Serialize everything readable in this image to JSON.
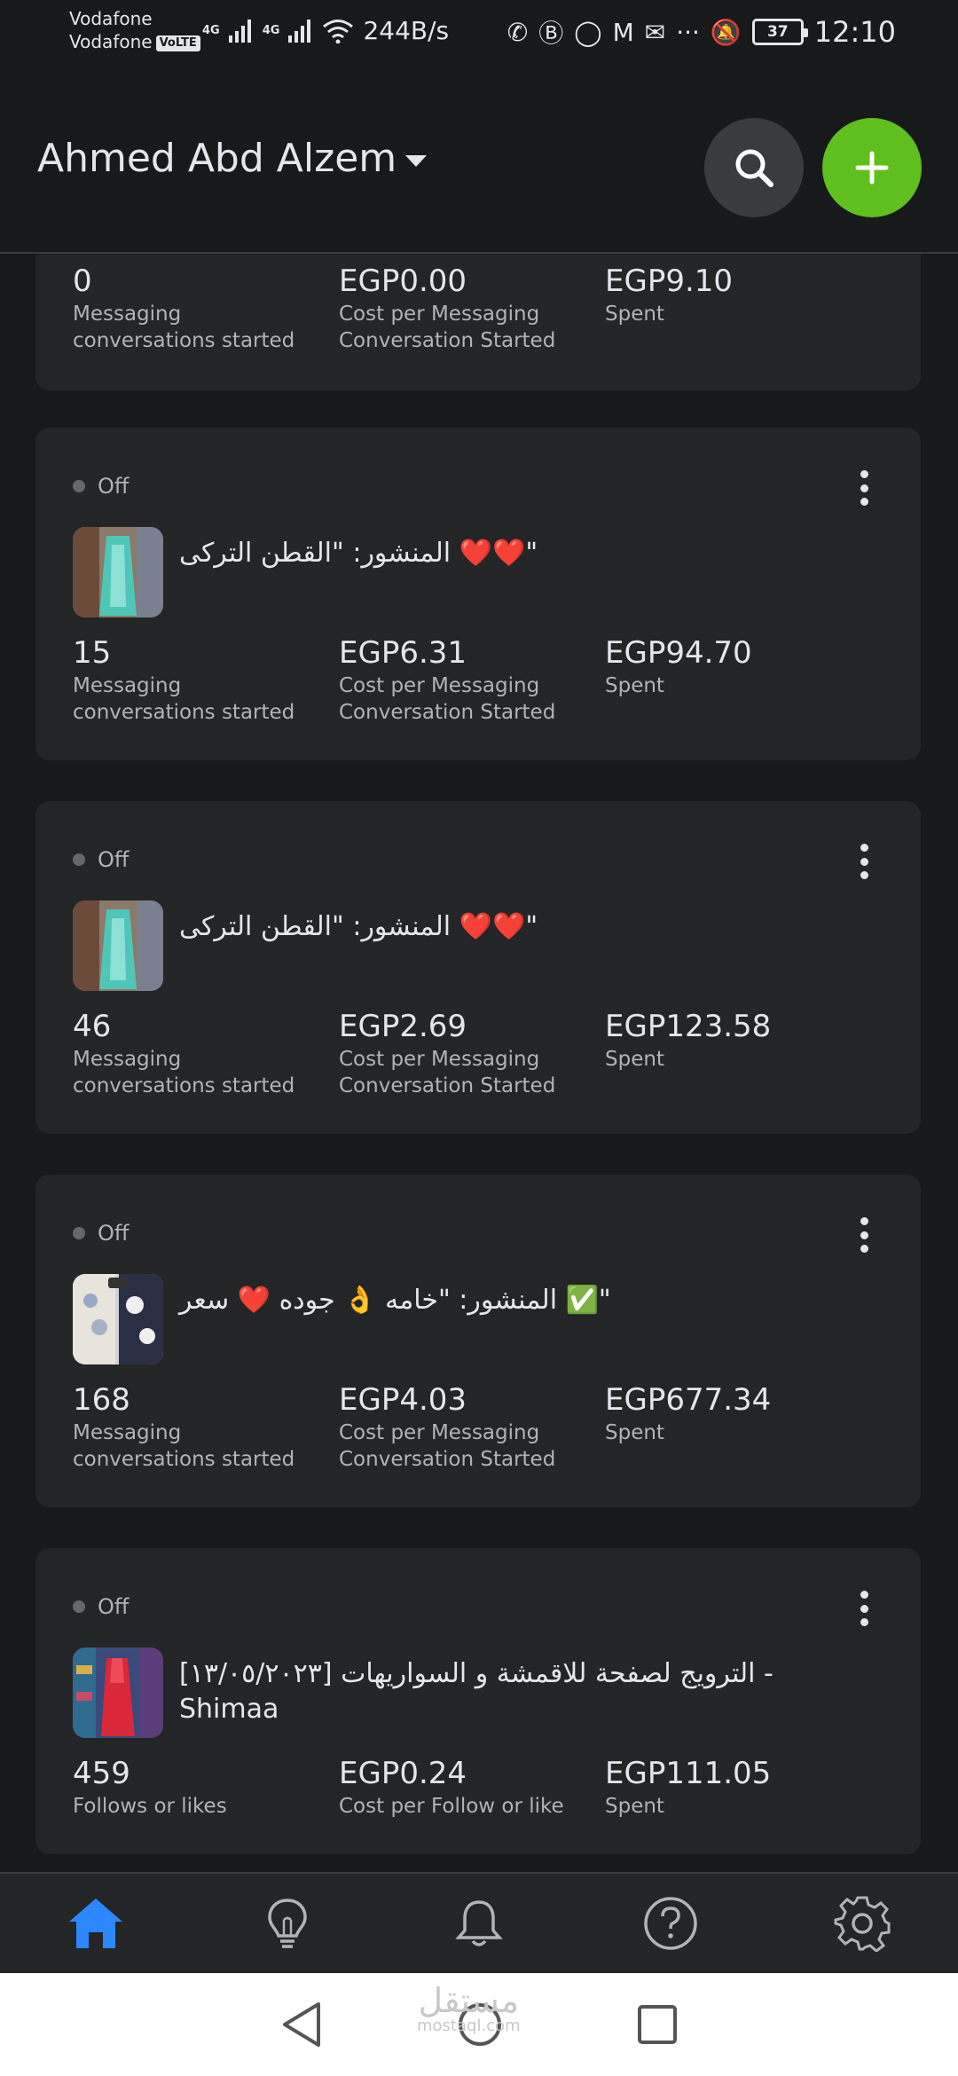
{
  "status_bar": {
    "carrier_1": "Vodafone",
    "carrier_2": "Vodafone",
    "volte": "VoLTE",
    "net_1": "4G",
    "net_2": "4G",
    "speed": "244B/s",
    "battery": "37",
    "time": "12:10"
  },
  "header": {
    "account_name": "Ahmed Abd Alzem",
    "search_icon": "search-icon",
    "add_icon": "plus-icon",
    "accent": "#5fbf1f"
  },
  "ads": [
    {
      "status": "",
      "title": "",
      "metrics": [
        {
          "value": "0",
          "label": "Messaging conversations started"
        },
        {
          "value": "EGP0.00",
          "label": "Cost per Messaging Conversation Started"
        },
        {
          "value": "EGP9.10",
          "label": "Spent"
        }
      ]
    },
    {
      "status": "Off",
      "title": "المنشور: \"القطن التركى ❤️❤️\"",
      "metrics": [
        {
          "value": "15",
          "label": "Messaging conversations started"
        },
        {
          "value": "EGP6.31",
          "label": "Cost per Messaging Conversation Started"
        },
        {
          "value": "EGP94.70",
          "label": "Spent"
        }
      ]
    },
    {
      "status": "Off",
      "title": "المنشور: \"القطن التركى ❤️❤️\"",
      "metrics": [
        {
          "value": "46",
          "label": "Messaging conversations started"
        },
        {
          "value": "EGP2.69",
          "label": "Cost per Messaging Conversation Started"
        },
        {
          "value": "EGP123.58",
          "label": "Spent"
        }
      ]
    },
    {
      "status": "Off",
      "title": "المنشور: \"خامه 👌 جوده ❤️ سعر ✅\"",
      "metrics": [
        {
          "value": "168",
          "label": "Messaging conversations started"
        },
        {
          "value": "EGP4.03",
          "label": "Cost per Messaging Conversation Started"
        },
        {
          "value": "EGP677.34",
          "label": "Spent"
        }
      ]
    },
    {
      "status": "Off",
      "title": "[١٣/٠٥/٢٠٢٣] الترويج لصفحة للاقمشة و السواريهات - Shimaa",
      "metrics": [
        {
          "value": "459",
          "label": "Follows or likes"
        },
        {
          "value": "EGP0.24",
          "label": "Cost per Follow or like"
        },
        {
          "value": "EGP111.05",
          "label": "Spent"
        }
      ]
    }
  ],
  "bottom_nav": {
    "items": [
      "home-icon",
      "lightbulb-icon",
      "bell-icon",
      "help-icon",
      "gear-icon"
    ],
    "active": "home-icon",
    "active_color": "#2d88ff"
  },
  "watermark": {
    "arabic": "مستقل",
    "latin": "mostaql.com"
  }
}
